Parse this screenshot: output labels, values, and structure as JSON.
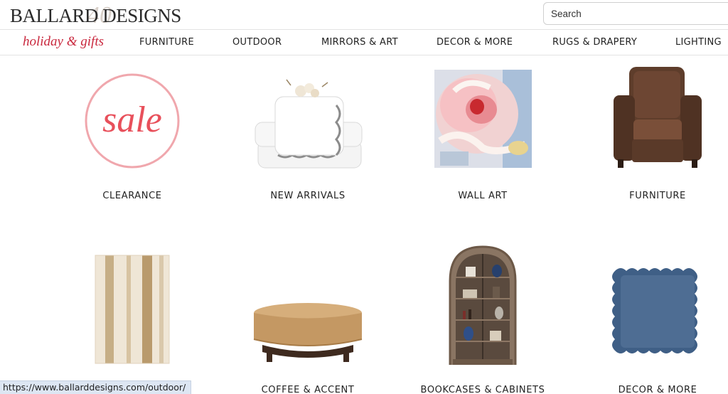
{
  "brand": {
    "logo_text": "BALLARD DESIGNS",
    "logo_mark": "40"
  },
  "search": {
    "placeholder": "Search",
    "value": ""
  },
  "nav": {
    "holiday": "holiday & gifts",
    "items": [
      "FURNITURE",
      "OUTDOOR",
      "MIRRORS & ART",
      "DECOR & MORE",
      "RUGS & DRAPERY",
      "LIGHTING"
    ]
  },
  "categories": [
    {
      "label": "CLEARANCE",
      "badge": "sale",
      "icon": "sale-badge"
    },
    {
      "label": "NEW ARRIVALS",
      "icon": "towels-image"
    },
    {
      "label": "WALL ART",
      "icon": "floral-painting-image"
    },
    {
      "label": "FURNITURE",
      "icon": "leather-armchair-image"
    },
    {
      "label": "",
      "icon": "striped-rug-image"
    },
    {
      "label": "COFFEE & ACCENT",
      "icon": "round-coffee-table-image"
    },
    {
      "label": "BOOKCASES & CABINETS",
      "icon": "arched-cabinet-image"
    },
    {
      "label": "DECOR & MORE",
      "icon": "scalloped-pillow-image"
    }
  ],
  "status_bar": {
    "url": "https://www.ballarddesigns.com/outdoor/"
  },
  "colors": {
    "accent": "#c9283e",
    "sale_pink": "#f0a7ad",
    "status_bg": "#dde6f3"
  }
}
